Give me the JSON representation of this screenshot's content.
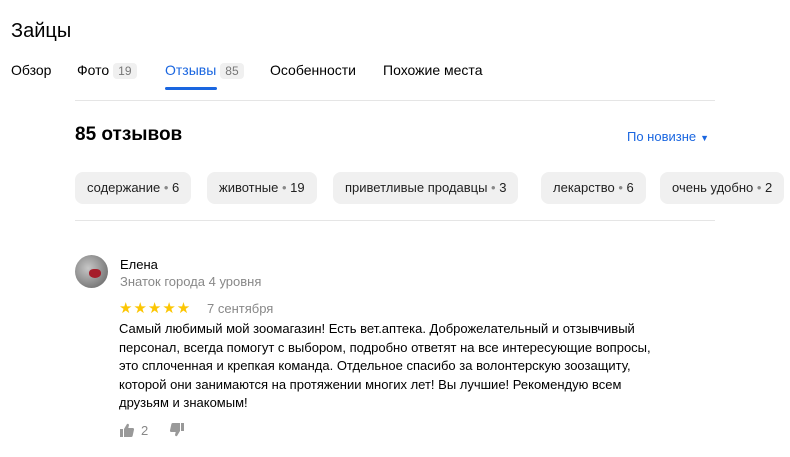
{
  "title": "Зайцы",
  "tabs": [
    {
      "label": "Обзор",
      "count": null
    },
    {
      "label": "Фото",
      "count": "19"
    },
    {
      "label": "Отзывы",
      "count": "85"
    },
    {
      "label": "Особенности",
      "count": null
    },
    {
      "label": "Похожие места",
      "count": null
    }
  ],
  "active_tab": "Отзывы",
  "reviews_header": {
    "count_text": "85 отзывов",
    "sort_label": "По новизне"
  },
  "chips": [
    {
      "label": "содержание",
      "count": "6"
    },
    {
      "label": "животные",
      "count": "19"
    },
    {
      "label": "приветливые продавцы",
      "count": "3"
    },
    {
      "label": "лекарство",
      "count": "6"
    },
    {
      "label": "очень удобно",
      "count": "2"
    }
  ],
  "review": {
    "author": "Елена",
    "level": "Знаток города 4 уровня",
    "rating": 5,
    "stars": "★★★★★",
    "date": "7 сентября",
    "lines": [
      "Самый любимый мой зоомагазин! Есть вет.аптека. Доброжелательный и отзывчивый",
      "персонал, всегда помогут с выбором, подробно ответят на все интересующие вопросы,",
      "это сплоченная и крепкая команда. Отдельное спасибо за волонтерскую зоозащиту,",
      "которой они занимаются на протяжении многих лет! Вы лучшие! Рекомендую всем",
      "друзьям и знакомым!"
    ],
    "likes": "2"
  },
  "colors": {
    "accent": "#1a66e0",
    "star": "#fcc603",
    "muted": "#888888",
    "chip_bg": "#f0f0f0"
  }
}
